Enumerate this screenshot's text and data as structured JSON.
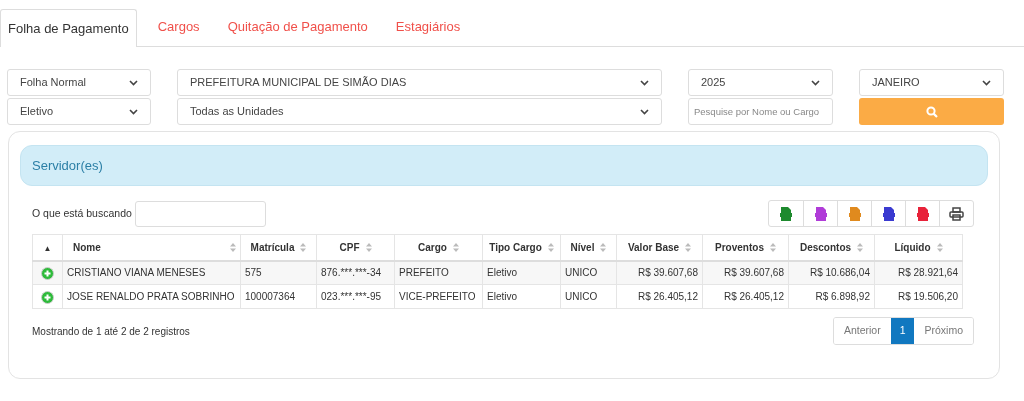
{
  "tabs": [
    {
      "label": "Folha de Pagamento",
      "selected": true
    },
    {
      "label": "Cargos",
      "selected": false
    },
    {
      "label": "Quitação de Pagamento",
      "selected": false
    },
    {
      "label": "Estagiários",
      "selected": false
    }
  ],
  "filters": {
    "folha": "Folha Normal",
    "orgao": "PREFEITURA MUNICIPAL DE SIMÃO DIAS",
    "ano": "2025",
    "mes": "JANEIRO",
    "vinculo": "Eletivo",
    "unidade": "Todas as Unidades",
    "search_placeholder": "Pesquise por Nome ou Cargo"
  },
  "panel": {
    "title": "Servidor(es)",
    "search_label": "O que está buscando",
    "exports": [
      {
        "kind": "file",
        "color": "#1e8a2e"
      },
      {
        "kind": "file",
        "color": "#b03cd8"
      },
      {
        "kind": "file",
        "color": "#e08a1e"
      },
      {
        "kind": "file",
        "color": "#3a3ad0"
      },
      {
        "kind": "file",
        "color": "#e8223a"
      },
      {
        "kind": "print",
        "color": "#444444"
      }
    ],
    "table": {
      "sort_mark": "▲",
      "columns": [
        "Nome",
        "Matrícula",
        "CPF",
        "Cargo",
        "Tipo Cargo",
        "Nível",
        "Valor Base",
        "Proventos",
        "Descontos",
        "Líquido"
      ],
      "rows": [
        [
          "CRISTIANO VIANA MENESES",
          "575",
          "876.***.***-34",
          "PREFEITO",
          "Eletivo",
          "UNICO",
          "R$ 39.607,68",
          "R$ 39.607,68",
          "R$ 10.686,04",
          "R$ 28.921,64"
        ],
        [
          "JOSE RENALDO PRATA SOBRINHO",
          "100007364",
          "023.***.***-95",
          "VICE-PREFEITO",
          "Eletivo",
          "UNICO",
          "R$ 26.405,12",
          "R$ 26.405,12",
          "R$ 6.898,92",
          "R$ 19.506,20"
        ]
      ]
    },
    "info": "Mostrando de 1 até 2 de 2 registros",
    "pagination": [
      {
        "label": "Anterior",
        "selected": false
      },
      {
        "label": "1",
        "selected": true
      },
      {
        "label": "Próximo",
        "selected": false
      }
    ]
  }
}
